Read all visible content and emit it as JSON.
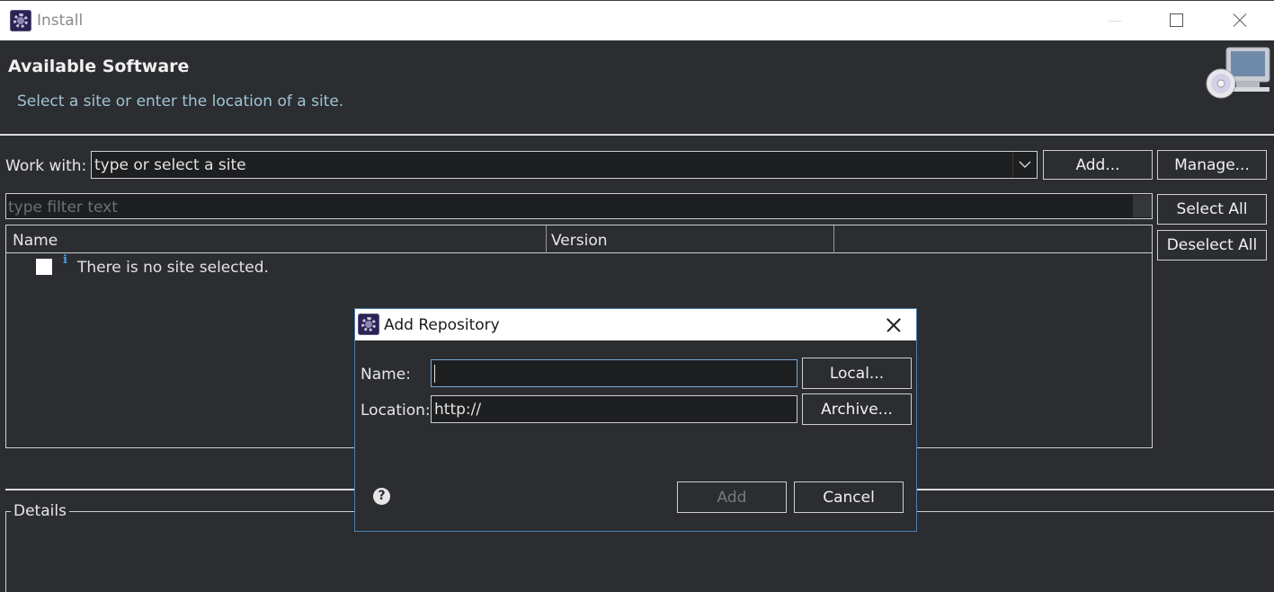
{
  "window": {
    "title": "Install",
    "icon": "eclipse-icon"
  },
  "banner": {
    "title": "Available Software",
    "subtitle": "Select a site or enter the location of a site.",
    "icon": "install-software-icon"
  },
  "work_with": {
    "label": "Work with:",
    "combo_value": "type or select a site",
    "add_label": "Add...",
    "manage_label": "Manage..."
  },
  "filter": {
    "placeholder": "type filter text"
  },
  "table": {
    "columns": [
      "Name",
      "Version",
      ""
    ],
    "rows": [
      {
        "checked": false,
        "icon": "info-icon",
        "text": "There is no site selected."
      }
    ]
  },
  "side_buttons": {
    "select_all": "Select All",
    "deselect_all": "Deselect All"
  },
  "details": {
    "label": "Details"
  },
  "dialog": {
    "title": "Add Repository",
    "name_label": "Name:",
    "name_value": "",
    "location_label": "Location:",
    "location_value": "http://",
    "local_label": "Local...",
    "archive_label": "Archive...",
    "add_label": "Add",
    "cancel_label": "Cancel",
    "add_enabled": false
  },
  "colors": {
    "background": "#2b2d30",
    "input_background": "#1d1f21",
    "subtitle": "#9fc4d6",
    "info_accent": "#4a9fe0",
    "dialog_border": "#4b7fb6"
  }
}
